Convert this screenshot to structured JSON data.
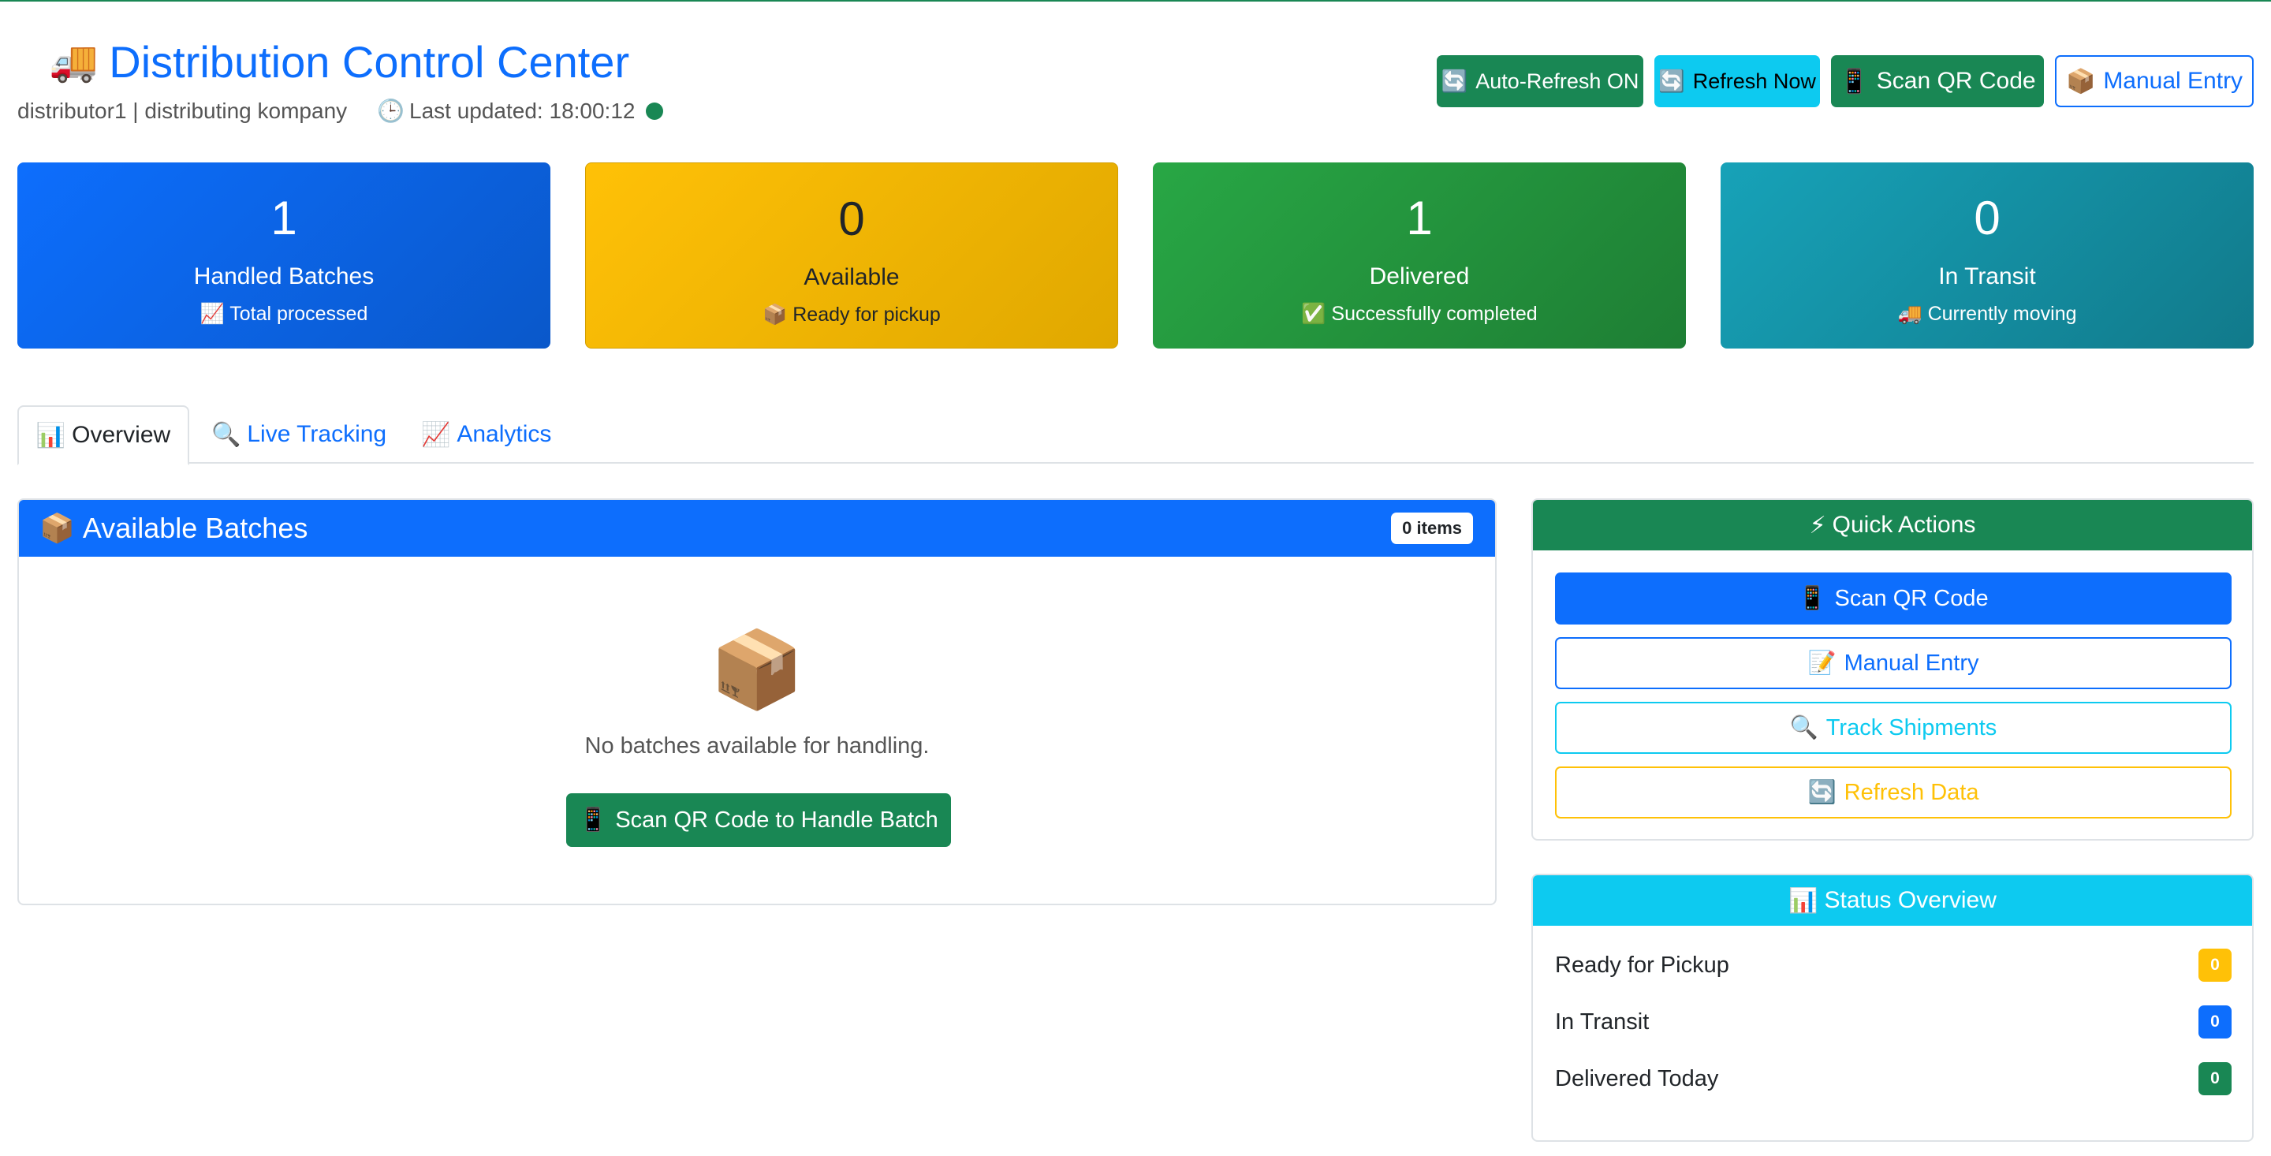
{
  "header": {
    "title": "Distribution Control Center",
    "user": "distributor1 | distributing kompany",
    "last_updated": "Last updated: 18:00:12",
    "buttons": {
      "auto_refresh": "Auto-Refresh ON",
      "refresh_now": "Refresh Now",
      "scan_qr": "Scan QR Code",
      "manual_entry": "Manual Entry"
    }
  },
  "stats": [
    {
      "value": "1",
      "label": "Handled Batches",
      "sub": "Total processed",
      "icon": "chart-up-icon",
      "color": "#0d6efd"
    },
    {
      "value": "0",
      "label": "Available",
      "sub": "Ready for pickup",
      "icon": "package-icon",
      "color": "#ffc107"
    },
    {
      "value": "1",
      "label": "Delivered",
      "sub": "Successfully completed",
      "icon": "check-icon",
      "color": "#28a745"
    },
    {
      "value": "0",
      "label": "In Transit",
      "sub": "Currently moving",
      "icon": "truck-icon",
      "color": "#17a2b8"
    }
  ],
  "tabs": [
    {
      "label": "Overview",
      "icon": "bar-chart-icon",
      "active": true
    },
    {
      "label": "Live Tracking",
      "icon": "search-icon",
      "active": false
    },
    {
      "label": "Analytics",
      "icon": "chart-up-icon",
      "active": false
    }
  ],
  "available": {
    "title": "Available Batches",
    "count_badge": "0 items",
    "empty_text": "No batches available for handling.",
    "empty_button": "Scan QR Code to Handle Batch"
  },
  "quick_actions": {
    "title": "Quick Actions",
    "buttons": [
      "Scan QR Code",
      "Manual Entry",
      "Track Shipments",
      "Refresh Data"
    ]
  },
  "status_overview": {
    "title": "Status Overview",
    "rows": [
      {
        "label": "Ready for Pickup",
        "count": "0",
        "color": "#ffc107"
      },
      {
        "label": "In Transit",
        "count": "0",
        "color": "#0d6efd"
      },
      {
        "label": "Delivered Today",
        "count": "0",
        "color": "#198754"
      }
    ]
  }
}
